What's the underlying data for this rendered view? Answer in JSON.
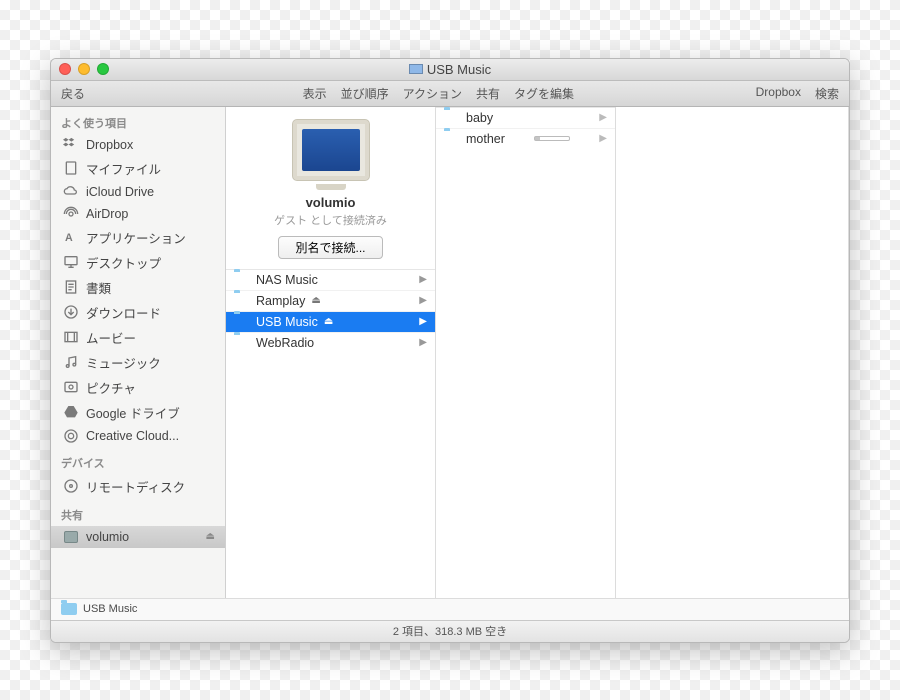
{
  "window": {
    "title": "USB Music"
  },
  "toolbar": {
    "back": "戻る",
    "menu": [
      "表示",
      "並び順序",
      "アクション",
      "共有",
      "タグを編集"
    ],
    "right": [
      "Dropbox",
      "検索"
    ]
  },
  "sidebar": {
    "sections": [
      {
        "title": "よく使う項目",
        "items": [
          {
            "icon": "dropbox",
            "label": "Dropbox"
          },
          {
            "icon": "file",
            "label": "マイファイル"
          },
          {
            "icon": "cloud",
            "label": "iCloud Drive"
          },
          {
            "icon": "airdrop",
            "label": "AirDrop"
          },
          {
            "icon": "apps",
            "label": "アプリケーション"
          },
          {
            "icon": "desktop",
            "label": "デスクトップ"
          },
          {
            "icon": "docs",
            "label": "書類"
          },
          {
            "icon": "downloads",
            "label": "ダウンロード"
          },
          {
            "icon": "movies",
            "label": "ムービー"
          },
          {
            "icon": "music",
            "label": "ミュージック"
          },
          {
            "icon": "pictures",
            "label": "ピクチャ"
          },
          {
            "icon": "gdrive",
            "label": "Google ドライブ"
          },
          {
            "icon": "cc",
            "label": "Creative Cloud..."
          }
        ]
      },
      {
        "title": "デバイス",
        "items": [
          {
            "icon": "disc",
            "label": "リモートディスク"
          }
        ]
      },
      {
        "title": "共有",
        "items": [
          {
            "icon": "server",
            "label": "volumio",
            "eject": true,
            "selected": true
          }
        ]
      }
    ]
  },
  "server": {
    "name": "volumio",
    "status": "ゲスト として接続済み",
    "button": "別名で接続..."
  },
  "col1": [
    {
      "label": "NAS Music",
      "chev": true
    },
    {
      "label": "Ramplay",
      "eject": true,
      "chev": true
    },
    {
      "label": "USB Music",
      "eject": true,
      "chev": true,
      "selected": true
    },
    {
      "label": "WebRadio",
      "chev": true
    }
  ],
  "col2": [
    {
      "label": "baby",
      "chev": true
    },
    {
      "label": "mother",
      "capacity": true,
      "chev": true
    }
  ],
  "path": "USB Music",
  "status": "2 項目、318.3 MB 空き"
}
